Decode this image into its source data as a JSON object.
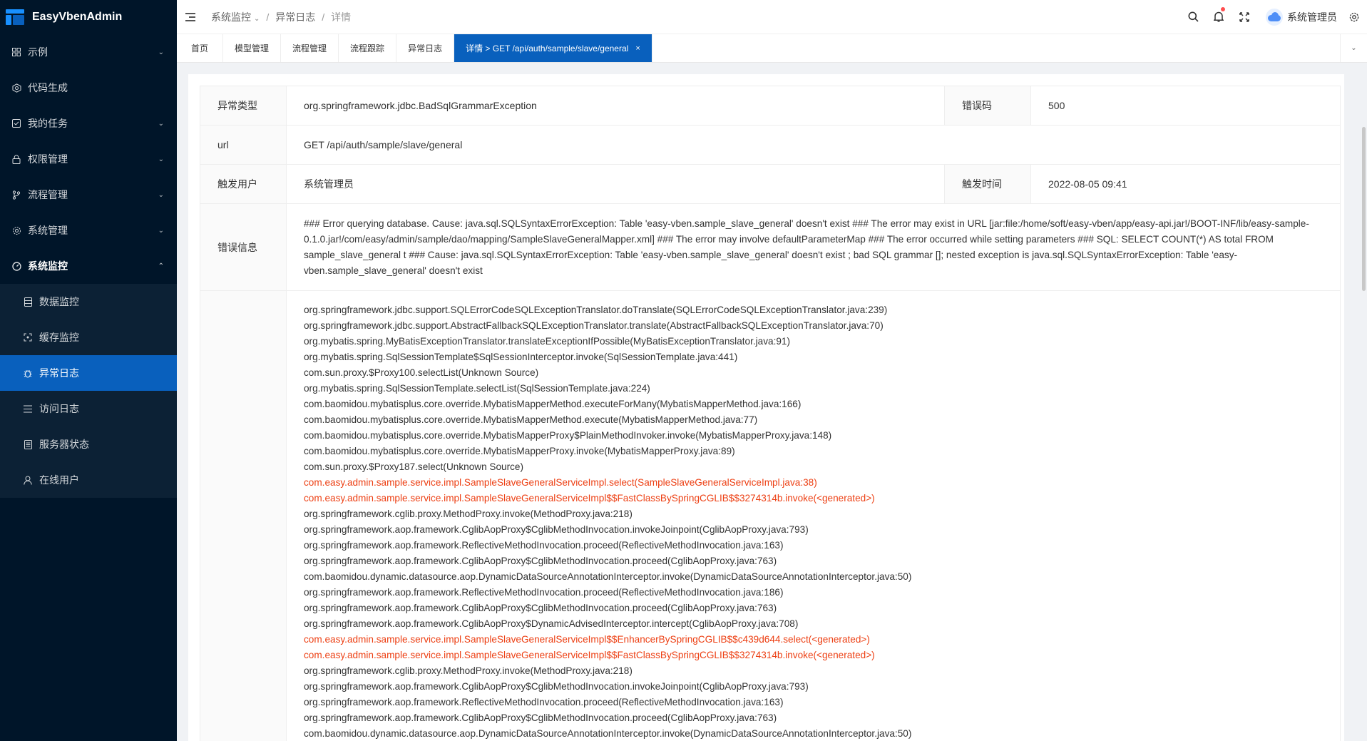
{
  "app": {
    "title": "EasyVbenAdmin"
  },
  "sidebar": {
    "items": [
      {
        "label": "示例",
        "icon": "grid-icon",
        "expandable": true
      },
      {
        "label": "代码生成",
        "icon": "gear-cube-icon",
        "expandable": false
      },
      {
        "label": "我的任务",
        "icon": "task-check-icon",
        "expandable": true
      },
      {
        "label": "权限管理",
        "icon": "lock-icon",
        "expandable": true
      },
      {
        "label": "流程管理",
        "icon": "branch-icon",
        "expandable": true
      },
      {
        "label": "系统管理",
        "icon": "settings-icon",
        "expandable": true
      },
      {
        "label": "系统监控",
        "icon": "dashboard-icon",
        "expandable": true,
        "open": true
      }
    ],
    "monitor_children": [
      {
        "label": "数据监控",
        "icon": "database-icon"
      },
      {
        "label": "缓存监控",
        "icon": "cache-icon"
      },
      {
        "label": "异常日志",
        "icon": "bug-icon",
        "active": true
      },
      {
        "label": "访问日志",
        "icon": "list-icon"
      },
      {
        "label": "服务器状态",
        "icon": "server-icon"
      },
      {
        "label": "在线用户",
        "icon": "user-icon"
      }
    ]
  },
  "header": {
    "breadcrumb": [
      "系统监控",
      "异常日志",
      "详情"
    ],
    "user_name": "系统管理员"
  },
  "tabs": [
    {
      "label": "首页"
    },
    {
      "label": "模型管理"
    },
    {
      "label": "流程管理"
    },
    {
      "label": "流程跟踪"
    },
    {
      "label": "异常日志"
    },
    {
      "label": "详情 > GET /api/auth/sample/slave/general",
      "active": true,
      "closable": true
    }
  ],
  "detail": {
    "exception_type_label": "异常类型",
    "exception_type": "org.springframework.jdbc.BadSqlGrammarException",
    "error_code_label": "错误码",
    "error_code": "500",
    "url_label": "url",
    "url": "GET /api/auth/sample/slave/general",
    "trigger_user_label": "触发用户",
    "trigger_user": "系统管理员",
    "trigger_time_label": "触发时间",
    "trigger_time": "2022-08-05 09:41",
    "error_message_label": "错误信息",
    "error_message": "### Error querying database. Cause: java.sql.SQLSyntaxErrorException: Table 'easy-vben.sample_slave_general' doesn't exist ### The error may exist in URL [jar:file:/home/soft/easy-vben/app/easy-api.jar!/BOOT-INF/lib/easy-sample-0.1.0.jar!/com/easy/admin/sample/dao/mapping/SampleSlaveGeneralMapper.xml] ### The error may involve defaultParameterMap ### The error occurred while setting parameters ### SQL: SELECT COUNT(*) AS total FROM sample_slave_general t ### Cause: java.sql.SQLSyntaxErrorException: Table 'easy-vben.sample_slave_general' doesn't exist ; bad SQL grammar []; nested exception is java.sql.SQLSyntaxErrorException: Table 'easy-vben.sample_slave_general' doesn't exist",
    "stack_trace": [
      {
        "text": "org.springframework.jdbc.support.SQLErrorCodeSQLExceptionTranslator.doTranslate(SQLErrorCodeSQLExceptionTranslator.java:239)",
        "highlight": false
      },
      {
        "text": "org.springframework.jdbc.support.AbstractFallbackSQLExceptionTranslator.translate(AbstractFallbackSQLExceptionTranslator.java:70)",
        "highlight": false
      },
      {
        "text": "org.mybatis.spring.MyBatisExceptionTranslator.translateExceptionIfPossible(MyBatisExceptionTranslator.java:91)",
        "highlight": false
      },
      {
        "text": "org.mybatis.spring.SqlSessionTemplate$SqlSessionInterceptor.invoke(SqlSessionTemplate.java:441)",
        "highlight": false
      },
      {
        "text": "com.sun.proxy.$Proxy100.selectList(Unknown Source)",
        "highlight": false
      },
      {
        "text": "org.mybatis.spring.SqlSessionTemplate.selectList(SqlSessionTemplate.java:224)",
        "highlight": false
      },
      {
        "text": "com.baomidou.mybatisplus.core.override.MybatisMapperMethod.executeForMany(MybatisMapperMethod.java:166)",
        "highlight": false
      },
      {
        "text": "com.baomidou.mybatisplus.core.override.MybatisMapperMethod.execute(MybatisMapperMethod.java:77)",
        "highlight": false
      },
      {
        "text": "com.baomidou.mybatisplus.core.override.MybatisMapperProxy$PlainMethodInvoker.invoke(MybatisMapperProxy.java:148)",
        "highlight": false
      },
      {
        "text": "com.baomidou.mybatisplus.core.override.MybatisMapperProxy.invoke(MybatisMapperProxy.java:89)",
        "highlight": false
      },
      {
        "text": "com.sun.proxy.$Proxy187.select(Unknown Source)",
        "highlight": false
      },
      {
        "text": "com.easy.admin.sample.service.impl.SampleSlaveGeneralServiceImpl.select(SampleSlaveGeneralServiceImpl.java:38)",
        "highlight": true
      },
      {
        "text": "com.easy.admin.sample.service.impl.SampleSlaveGeneralServiceImpl$$FastClassBySpringCGLIB$$3274314b.invoke(<generated>)",
        "highlight": true
      },
      {
        "text": "org.springframework.cglib.proxy.MethodProxy.invoke(MethodProxy.java:218)",
        "highlight": false
      },
      {
        "text": "org.springframework.aop.framework.CglibAopProxy$CglibMethodInvocation.invokeJoinpoint(CglibAopProxy.java:793)",
        "highlight": false
      },
      {
        "text": "org.springframework.aop.framework.ReflectiveMethodInvocation.proceed(ReflectiveMethodInvocation.java:163)",
        "highlight": false
      },
      {
        "text": "org.springframework.aop.framework.CglibAopProxy$CglibMethodInvocation.proceed(CglibAopProxy.java:763)",
        "highlight": false
      },
      {
        "text": "com.baomidou.dynamic.datasource.aop.DynamicDataSourceAnnotationInterceptor.invoke(DynamicDataSourceAnnotationInterceptor.java:50)",
        "highlight": false
      },
      {
        "text": "org.springframework.aop.framework.ReflectiveMethodInvocation.proceed(ReflectiveMethodInvocation.java:186)",
        "highlight": false
      },
      {
        "text": "org.springframework.aop.framework.CglibAopProxy$CglibMethodInvocation.proceed(CglibAopProxy.java:763)",
        "highlight": false
      },
      {
        "text": "org.springframework.aop.framework.CglibAopProxy$DynamicAdvisedInterceptor.intercept(CglibAopProxy.java:708)",
        "highlight": false
      },
      {
        "text": "com.easy.admin.sample.service.impl.SampleSlaveGeneralServiceImpl$$EnhancerBySpringCGLIB$$c439d644.select(<generated>)",
        "highlight": true
      },
      {
        "text": "com.easy.admin.sample.service.impl.SampleSlaveGeneralServiceImpl$$FastClassBySpringCGLIB$$3274314b.invoke(<generated>)",
        "highlight": true
      },
      {
        "text": "org.springframework.cglib.proxy.MethodProxy.invoke(MethodProxy.java:218)",
        "highlight": false
      },
      {
        "text": "org.springframework.aop.framework.CglibAopProxy$CglibMethodInvocation.invokeJoinpoint(CglibAopProxy.java:793)",
        "highlight": false
      },
      {
        "text": "org.springframework.aop.framework.ReflectiveMethodInvocation.proceed(ReflectiveMethodInvocation.java:163)",
        "highlight": false
      },
      {
        "text": "org.springframework.aop.framework.CglibAopProxy$CglibMethodInvocation.proceed(CglibAopProxy.java:763)",
        "highlight": false
      },
      {
        "text": "com.baomidou.dynamic.datasource.aop.DynamicDataSourceAnnotationInterceptor.invoke(DynamicDataSourceAnnotationInterceptor.java:50)",
        "highlight": false
      }
    ]
  },
  "colors": {
    "sidebar_bg": "#001529",
    "accent": "#0960bd",
    "error_text": "#ed4014"
  }
}
